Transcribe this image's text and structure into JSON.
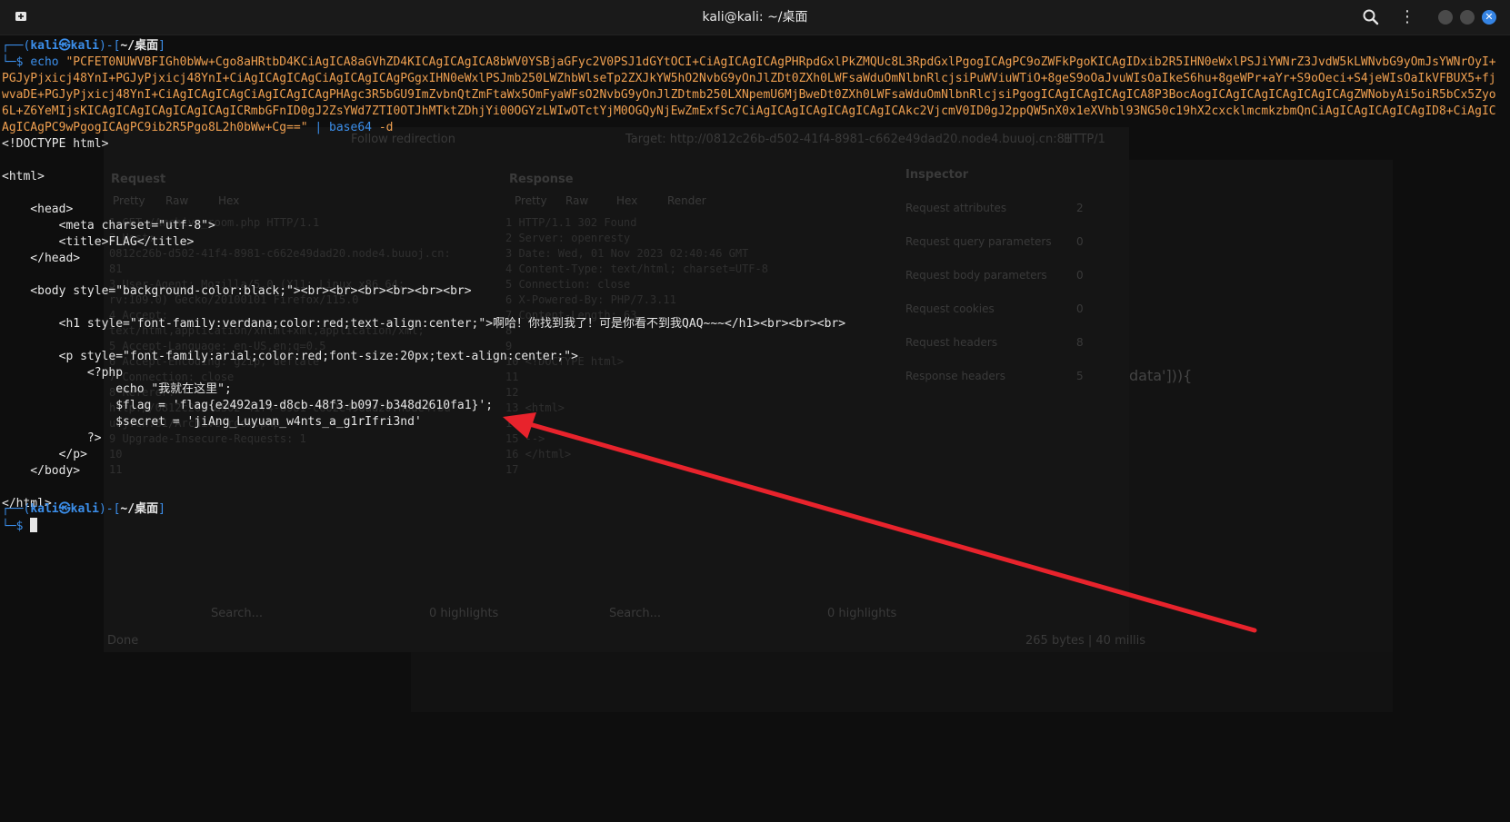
{
  "window": {
    "title": "kali@kali: ~/桌面",
    "new_tab_icon": "new-tab-icon",
    "search_icon": "search-icon",
    "menu_icon": "kebab-menu-icon",
    "close_glyph": "✕"
  },
  "terminal": {
    "prompt1": {
      "open": "┌──(",
      "user": "kali㉿kali",
      "mid": ")-[",
      "dir": "~/桌面",
      "close": "]"
    },
    "prompt1_line2_prefix": "└─$ ",
    "cmd_echo": "echo",
    "cmd_arg": "\"PCFET0NUWVBFIGh0bWw+Cgo8aHRtbD4KCiAgICA8aGVhZD4KICAgICAgICA8bWV0YSBjaGFyc2V0PSJ1dGYtOCI+CiAgICAgICAgPHRpdGxlPkZMQUc8L3RpdGxlPgogICAgPC9oZWFkPgoKICAgIDxib2R5IHN0eWxlPSJiYWNrZ3JvdW5kLWNvbG9yOmJsYWNrOyI+PGJyPjxicj48YnI+PGJyPjxicj48YnI+CiAgICAgICAgCiAgICAgICAgPGgxIHN0eWxlPSJmb250LWZhbWlseTp2ZXJkYW5hO2NvbG9yOnJlZDt0ZXh0LWFsaWduOmNlbnRlcjsiPuWViuWTiO+8geS9oOaJvuWIsOaIkeS6hu+8geWPr+aYr+S9oOeci+S4jeWIsOaIkVFBUX5+fjwvaDE+PGJyPjxicj48YnI+CiAgICAgICAgCiAgICAgICAgPHAgc3R5bGU9ImZvbnQtZmFtaWx5OmFyaWFsO2NvbG9yOnJlZDtmb250LXNpemU6MjBweDt0ZXh0LWFsaWduOmNlbnRlcjsiPgogICAgICAgICAgICA8P3BocAogICAgICAgICAgICAgICAgZWNobyAi5oiR5bCx5Zyo6L+Z6YeMIjsKICAgICAgICAgICAgICAgICRmbGFnID0gJ2ZsYWd7ZTI0OTJhMTktZDhjYi00OGYzLWIwOTctYjM0OGQyNjEwZmExfSc7CiAgICAgICAgICAgICAgICAkc2VjcmV0ID0gJ2ppQW5nX0x1eXVhbl93NG50c19hX2cxcklmcmkzbmQnCiAgICAgICAgICAgID8+CiAgICAgICAgPC9wPgogICAgPC9ib2R5Pgo8L2h0bWw+Cg==\"",
    "cmd_pipe": "|",
    "cmd_decode": "base64",
    "cmd_flag": "-d",
    "output": [
      "<!DOCTYPE html>",
      "",
      "<html>",
      "",
      "    <head>",
      "        <meta charset=\"utf-8\">",
      "        <title>FLAG</title>",
      "    </head>",
      "",
      "    <body style=\"background-color:black;\"><br><br><br><br><br><br>",
      "",
      "        <h1 style=\"font-family:verdana;color:red;text-align:center;\">啊哈！你找到我了！可是你看不到我QAQ~~~</h1><br><br><br>",
      "",
      "        <p style=\"font-family:arial;color:red;font-size:20px;text-align:center;\">",
      "            <?php",
      "                echo \"我就在这里\";",
      "                $flag = 'flag{e2492a19-d8cb-48f3-b097-b348d2610fa1}';",
      "                $secret = 'jiAng_Luyuan_w4nts_a_g1rIfri3nd'",
      "            ?>",
      "        </p>",
      "    </body>",
      "",
      "</html>"
    ],
    "prompt2": {
      "open": "┌──(",
      "user": "kali㉿kali",
      "mid": ")-[",
      "dir": "~/桌面",
      "close": "]"
    },
    "prompt2_line2_prefix": "└─$ "
  },
  "background_app": {
    "follow_redirection": "Follow redirection",
    "target": "Target: http://0812c26b-d502-41f4-8981-c662e49dad20.node4.buuoj.cn:81",
    "http_version": "HTTP/1",
    "request_title": "Request",
    "response_title": "Response",
    "inspector_title": "Inspector",
    "request_tabs": [
      "Pretty",
      "Raw",
      "Hex"
    ],
    "response_tabs": [
      "Pretty",
      "Raw",
      "Hex",
      "Render"
    ],
    "inspector_rows": [
      {
        "label": "Request attributes",
        "count": "2"
      },
      {
        "label": "Request query parameters",
        "count": "0"
      },
      {
        "label": "Request body parameters",
        "count": "0"
      },
      {
        "label": "Request cookies",
        "count": "0"
      },
      {
        "label": "Request headers",
        "count": "8"
      },
      {
        "label": "Response headers",
        "count": "5"
      }
    ],
    "response_lines": [
      "1  HTTP/1.1 302 Found",
      "2  Server: openresty",
      "3  Date: Wed, 01 Nov 2023 02:40:46 GMT",
      "4  Content-Type: text/html; charset=UTF-8",
      "5  Connection: close",
      "6  X-Powered-By: PHP/7.3.11",
      "7  Content-Length: 63",
      "8",
      "9",
      "10 <!DOCTYPE html>",
      "11",
      "12",
      "13 <html>",
      "14",
      "15   -->",
      "16 </html>",
      "17"
    ],
    "request_lines": [
      "1  GET /Archive_room.php HTTP/1.1",
      "2  Host:",
      "   0812c26b-d502-41f4-8981-c662e49dad20.node4.buuoj.cn:",
      "   81",
      "3  User-Agent: Mozilla/5.0 (X11; Linux x86_64;",
      "   rv:109.0) Gecko/20100101 Firefox/115.0",
      "4  Accept:",
      "   text/html,application/xhtml+xml,application/xml;",
      "5  Accept-Language: en-US,en;q=0.5",
      "6  Accept-Encoding: gzip, deflate",
      "7  Connection: close",
      "8  Referer:",
      "   http://0812c26b-d502-41f4-8981-c662e49dad20.node4.bu",
      "   uoj.cn:81/Archive_room.php",
      "9  Upgrade-Insecure-Requests: 1",
      "10",
      "11"
    ],
    "search_placeholder": "Search...",
    "highlights": "0 highlights",
    "done": "Done",
    "footer_bytes": "265 bytes | 40 millis",
    "data_fragment": "data'])){"
  },
  "colors": {
    "prompt_blue": "#3b8eea",
    "string_orange": "#f0a050",
    "arrow_red": "#e8232c"
  }
}
